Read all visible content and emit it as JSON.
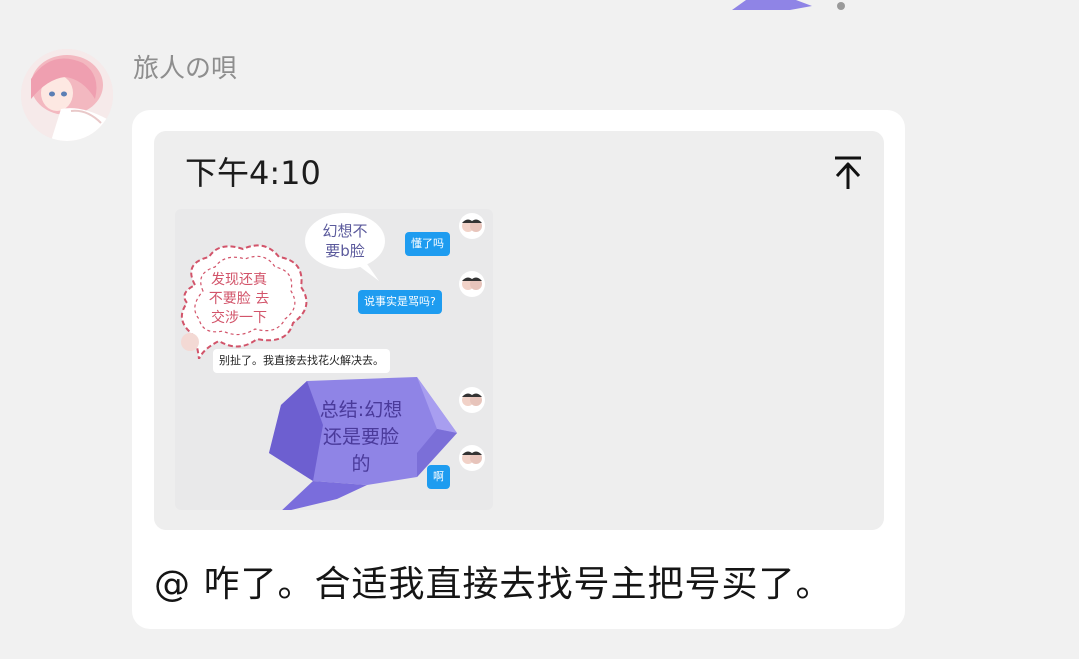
{
  "conversation": {
    "sender_name": "旅人の唄",
    "message_text": "@ 咋了。合适我直接去找号主把号买了。"
  },
  "quote": {
    "time": "下午4:10",
    "jump_icon": "scroll-to-top-icon",
    "screenshot": {
      "speech_bubble_text": "幻想不\n要b脸",
      "reply_blue_1": "懂了吗",
      "reply_blue_2": "说事实是骂吗?",
      "cloud_text": "发现还真\n不要脸 去\n交涉一下",
      "white_message": "别扯了。我直接去找花火解决去。",
      "crystal_text": "总结:幻想\n还是要脸\n的",
      "blue_fragment": "啊"
    }
  },
  "colors": {
    "page_bg": "#f1f1f1",
    "bubble_bg": "#ffffff",
    "quote_bg": "#eeeeee",
    "chat_blue": "#1e9cf0",
    "crystal_purple": "#8f84e6",
    "cloud_red": "#d2546a"
  }
}
